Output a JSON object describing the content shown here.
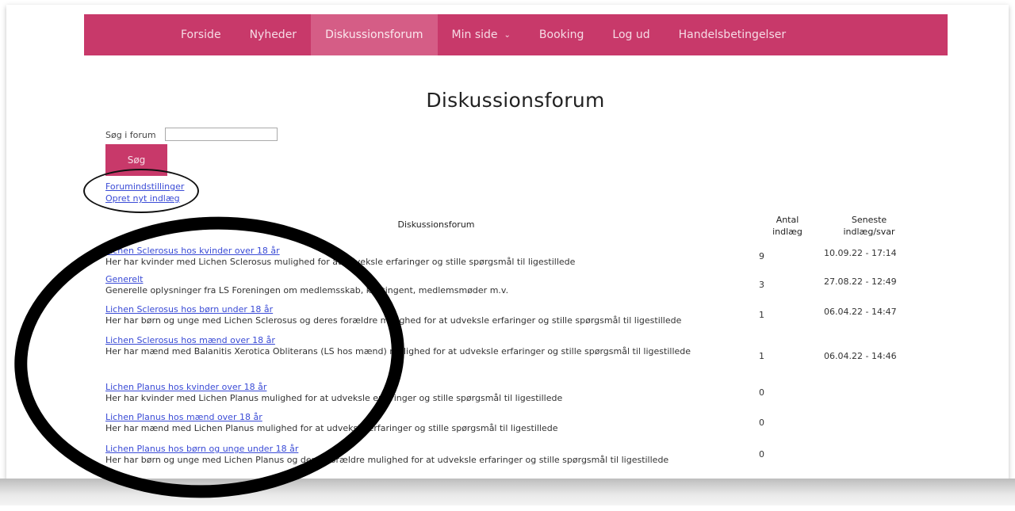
{
  "nav": {
    "items": [
      {
        "label": "Forside"
      },
      {
        "label": "Nyheder"
      },
      {
        "label": "Diskussionsforum"
      },
      {
        "label": "Min side"
      },
      {
        "label": "Booking"
      },
      {
        "label": "Log ud"
      },
      {
        "label": "Handelsbetingelser"
      }
    ],
    "active": "Diskussionsforum"
  },
  "page_title": "Diskussionsforum",
  "search": {
    "label": "Søg i forum",
    "value": "",
    "button": "Søg"
  },
  "links": {
    "settings": "Forumindstillinger",
    "new_post": "Opret nyt indlæg"
  },
  "table": {
    "col_forum": "Diskussionsforum",
    "col_count_1": "Antal",
    "col_count_2": "indlæg",
    "col_latest_1": "Seneste",
    "col_latest_2": "indlæg/svar",
    "rows": [
      {
        "title": "Lichen Sclerosus hos kvinder over 18 år",
        "desc": "Her har kvinder med Lichen Sclerosus mulighed for at udveksle erfaringer og stille spørgsmål til ligestillede",
        "count": "9",
        "latest": "10.09.22 - 17:14"
      },
      {
        "title": "Generelt",
        "desc": "Generelle oplysninger fra LS Foreningen om medlemsskab, kontingent, medlemsmøder m.v.",
        "count": "3",
        "latest": "27.08.22 - 12:49"
      },
      {
        "title": "Lichen Sclerosus hos børn under 18 år",
        "desc": "Her har børn og unge med Lichen Sclerosus og deres forældre mulighed for at udveksle erfaringer og stille spørgsmål til ligestillede",
        "count": "1",
        "latest": "06.04.22 - 14:47"
      },
      {
        "title": "Lichen Sclerosus hos mænd over 18 år",
        "desc": "Her har mænd med Balanitis Xerotica Obliterans (LS hos mænd) mulighed for at udveksle erfaringer og stille spørgsmål til ligestillede",
        "count": "1",
        "latest": "06.04.22 - 14:46"
      },
      {
        "title": "Lichen Planus hos kvinder over 18 år",
        "desc": "Her har kvinder med Lichen Planus mulighed for at udveksle erfaringer og stille spørgsmål til ligestillede",
        "count": "0",
        "latest": ""
      },
      {
        "title": "Lichen Planus hos mænd over 18 år",
        "desc": "Her har mænd med Lichen Planus mulighed for at udveksle erfaringer og stille spørgsmål til ligestillede",
        "count": "0",
        "latest": ""
      },
      {
        "title": "Lichen Planus hos børn og unge under 18 år",
        "desc": "Her har børn og unge med Lichen Planus og deres forældre mulighed for at udveksle erfaringer og stille spørgsmål til ligestillede",
        "count": "0",
        "latest": ""
      }
    ]
  }
}
